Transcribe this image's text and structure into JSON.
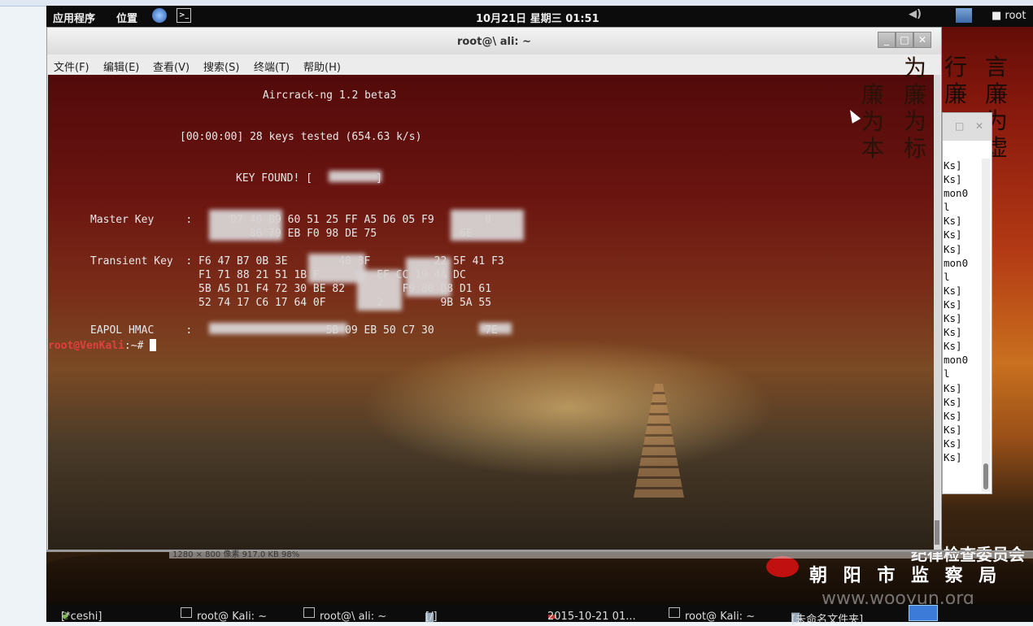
{
  "panel": {
    "apps": "应用程序",
    "places": "位置",
    "datetime": "10月21日 星期三 01:51",
    "user": "root"
  },
  "window": {
    "title": "root@\\ ali: ~",
    "menu": [
      "文件(F)",
      "编辑(E)",
      "查看(V)",
      "搜索(S)",
      "终端(T)",
      "帮助(H)"
    ]
  },
  "terminal": {
    "lines": [
      "            Aircrack-ng 1.2 beta3",
      "[00:00:00] 28 keys tested (654.63 k/s)",
      "KEY FOUND! [          ]",
      "Master Key     :      D7 46 B9 60 51 25 FF A5 D6 05 F9        0",
      "                         86 79 EB F0 98 DE 75             6E",
      "Transient Key  : F6 47 B7 0B 3E        48 3F          22 5F 41 F3",
      "                 F1 71 88 21 51 1B F         EF CC 19 4A DC",
      "                 5B A5 D1 F4 72 30 BE 82         F9 80 D8 D1 61",
      "                 52 74 17 C6 17 64 0F        2         9B 5A 55",
      "EAPOL HMAC     :                     5B 09 EB 50 C7 30        7E"
    ],
    "prompt_user": "root@VenKali",
    "prompt_rest": ":~#"
  },
  "bg_window": {
    "lines": [
      "Ks]",
      "Ks]",
      "mon0",
      "l",
      "Ks]",
      "Ks]",
      "Ks]",
      "mon0",
      "l",
      "Ks]",
      "Ks]",
      "Ks]",
      "Ks]",
      "Ks]",
      "mon0",
      "l",
      "Ks]",
      "Ks]",
      "Ks]",
      "Ks]",
      "Ks]",
      "Ks]"
    ]
  },
  "wallpaper": {
    "col1": [
      "言",
      "廉",
      "为",
      "虚"
    ],
    "col2": [
      "行",
      "廉"
    ],
    "col3": [
      "为",
      "廉",
      "为",
      "标"
    ],
    "col4": [
      "廉",
      "为",
      "本"
    ],
    "banner_top": "纪律检查委员会",
    "banner_bottom": "朝 阳 市 监 察 局",
    "strip_text": "1280 × 800 像素 917.0 KB 98%"
  },
  "taskbar": {
    "items": [
      "[*ceshi]",
      "root@     Kali: ~",
      "root@\\     ali: ~",
      "[/]",
      "2015-10-21 01...",
      "root@     Kali: ~",
      "[未命名文件夹]"
    ]
  },
  "watermark": "www.wooyun.org"
}
